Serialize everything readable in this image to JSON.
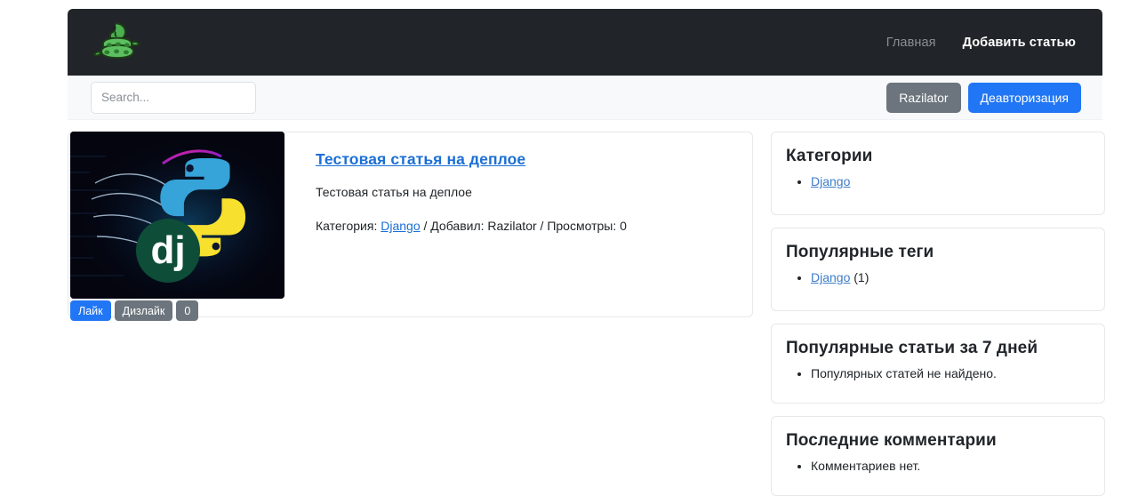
{
  "navbar": {
    "logo_icon": "green-snake-logo",
    "links": [
      {
        "label": "Главная",
        "active": false
      },
      {
        "label": "Добавить статью",
        "active": true
      }
    ]
  },
  "subbar": {
    "search": {
      "placeholder": "Search...",
      "value": ""
    },
    "user_button": "Razilator",
    "logout_button": "Деавторизация"
  },
  "article": {
    "title": "Тестовая статья на деплое",
    "description": "Тестовая статья на деплое",
    "meta": {
      "category_label": "Категория:",
      "category": "Django",
      "author_label": "/ Добавил:",
      "author": "Razilator",
      "views_label": "/ Просмотры:",
      "views": "0"
    },
    "thumbnail_icon": "python-django-logo-thumbnail",
    "like_button": "Лайк",
    "dislike_button": "Дизлайк",
    "vote_count": "0"
  },
  "sidebar": {
    "categories": {
      "title": "Категории",
      "items": [
        {
          "label": "Django",
          "suffix": ""
        }
      ]
    },
    "popular_tags": {
      "title": "Популярные теги",
      "items": [
        {
          "label": "Django",
          "suffix": " (1)"
        }
      ]
    },
    "popular_articles": {
      "title": "Популярные статьи за 7 дней",
      "empty_text": "Популярных статей не найдено."
    },
    "latest_comments": {
      "title": "Последние комментарии",
      "empty_text": "Комментариев нет."
    }
  },
  "colors": {
    "navbar_bg": "#212529",
    "primary": "#2176f5",
    "secondary": "#6c757d",
    "link": "#1b6fd4",
    "subbar_bg": "#f8f9fa"
  }
}
